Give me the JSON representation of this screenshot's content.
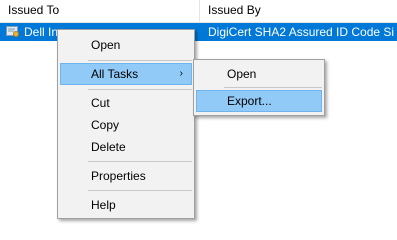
{
  "columns": {
    "issued_to": "Issued To",
    "issued_by": "Issued By"
  },
  "row": {
    "icon": "certificate-icon",
    "issued_to": "Dell In",
    "issued_by": "DigiCert SHA2 Assured ID Code Si..."
  },
  "context_menu": {
    "items": [
      {
        "label": "Open"
      },
      {
        "label": "All Tasks",
        "submenu_arrow": "›"
      },
      {
        "label": "Cut"
      },
      {
        "label": "Copy"
      },
      {
        "label": "Delete"
      },
      {
        "label": "Properties"
      },
      {
        "label": "Help"
      }
    ]
  },
  "submenu": {
    "items": [
      {
        "label": "Open"
      },
      {
        "label": "Export..."
      }
    ]
  },
  "colors": {
    "selection": "#0078d7",
    "menu_highlight": "#91c9f7"
  }
}
